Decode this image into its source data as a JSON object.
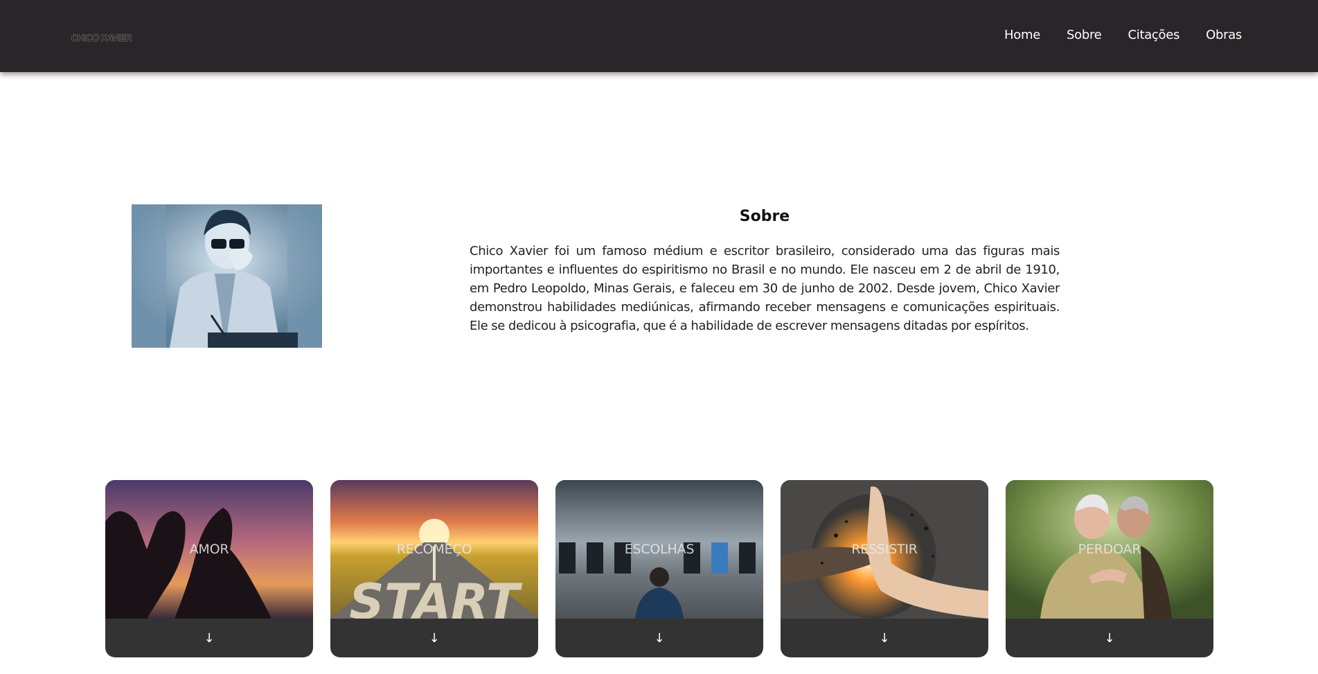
{
  "header": {
    "logo": "CHICO XAVIER",
    "nav": [
      "Home",
      "Sobre",
      "Citações",
      "Obras"
    ]
  },
  "about": {
    "title": "Sobre",
    "text": "Chico Xavier foi um famoso médium e escritor brasileiro, considerado uma das figuras mais importantes e influentes do espiritismo no Brasil e no mundo. Ele nasceu em 2 de abril de 1910, em Pedro Leopoldo, Minas Gerais, e faleceu em 30 de junho de 2002. Desde jovem, Chico Xavier demonstrou habilidades mediúnicas, afirmando receber mensagens e comunicações espirituais. Ele se dedicou à psicografia, que é a habilidade de escrever mensagens ditadas por espíritos."
  },
  "cards": [
    {
      "label": "AMOR",
      "arrow": "↓"
    },
    {
      "label": "RECOMEÇO",
      "arrow": "↓"
    },
    {
      "label": "ESCOLHAS",
      "arrow": "↓"
    },
    {
      "label": "RESSISTIR",
      "arrow": "↓"
    },
    {
      "label": "PERDOAR",
      "arrow": "↓"
    }
  ],
  "colors": {
    "navbar_bg": "#2a2529",
    "card_footer_bg": "#333333"
  }
}
